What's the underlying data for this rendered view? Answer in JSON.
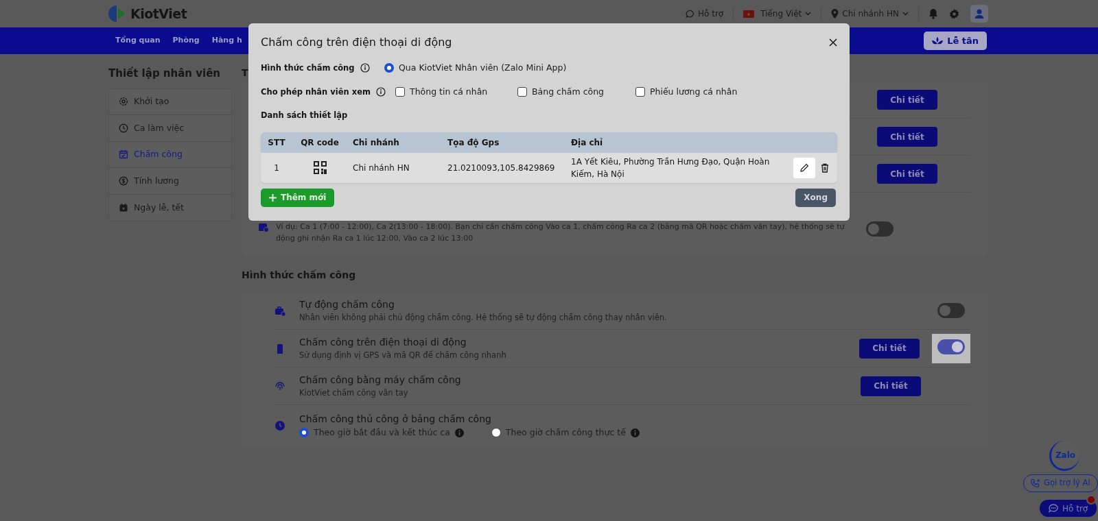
{
  "topbar": {
    "logo": "KiotViet",
    "support": "Hỗ trợ",
    "language": "Tiếng Việt",
    "branch": "Chi nhánh HN"
  },
  "navbar": {
    "items": [
      {
        "label": "Tổng quan"
      },
      {
        "label": "Phòng"
      },
      {
        "label": "Hàng h"
      }
    ],
    "reception_button": "Lễ tân"
  },
  "sidebar": {
    "title": "Thiết lập nhân viên",
    "items": [
      {
        "label": "Khởi tạo",
        "selected": false
      },
      {
        "label": "Ca làm việc",
        "selected": false
      },
      {
        "label": "Chấm công",
        "selected": true
      },
      {
        "label": "Tính lương",
        "selected": false
      },
      {
        "label": "Ngày lễ, tết",
        "selected": false
      }
    ]
  },
  "settings": {
    "heading": "T",
    "rows": [
      {
        "kind": "detail",
        "button": "Chi tiết"
      },
      {
        "kind": "detail",
        "button": "Chi tiết"
      },
      {
        "kind": "detail",
        "button": "Chi tiết"
      },
      {
        "kind": "toggle",
        "description": "Ví dụ: Ca 1 (7:00 - 12:00), Ca 2(13:00 - 18:00). Bạn chỉ cần chấm công Vào ca 1, chấm công Ra ca 2 (bằng mã QR hoặc chấm vân tay), hệ thống sẽ tự động ghi nhận Ra ca 1 lúc 12:00, Vào ca 2 lúc 13:00",
        "on": false
      }
    ]
  },
  "attendance_methods": {
    "title": "Hình thức chấm công",
    "rows": [
      {
        "kind": "toggle",
        "title": "Tự động chấm công",
        "description": "Nhân viên không phải chủ động chấm công. Hệ thống sẽ tự động chấm công thay nhân viên.",
        "on": false
      },
      {
        "kind": "detail_toggle",
        "title": "Chấm công trên điện thoại di động",
        "description": "Sử dụng định vị GPS và mã QR để chấm công nhanh",
        "button": "Chi tiết",
        "on": true
      },
      {
        "kind": "detail",
        "title": "Chấm công bằng máy chấm công",
        "description": "KiotViet chấm công vân tay",
        "button": "Chi tiết"
      },
      {
        "kind": "radios",
        "title": "Chấm công thủ công ở bảng chấm công",
        "options": [
          {
            "label": "Theo giờ bắt đầu và kết thúc ca",
            "selected": true
          },
          {
            "label": "Theo giờ chấm công thực tế",
            "selected": false
          }
        ]
      }
    ]
  },
  "modal": {
    "title": "Chấm công trên điện thoại di động",
    "method_label": "Hình thức chấm công",
    "method_options": [
      {
        "label": "Qua KiotViet Nhân viên (Zalo Mini App)",
        "selected": true
      }
    ],
    "view_label": "Cho phép nhân viên xem",
    "view_options": [
      {
        "label": "Thông tin cá nhân",
        "checked": false
      },
      {
        "label": "Bảng chấm công",
        "checked": false
      },
      {
        "label": "Phiếu lương cá nhân",
        "checked": false
      }
    ],
    "list_title": "Danh sách thiết lập",
    "table": {
      "columns": [
        "STT",
        "QR code",
        "Chi nhánh",
        "Tọa độ Gps",
        "Địa chỉ"
      ],
      "rows": [
        {
          "stt": "1",
          "branch": "Chi nhánh HN",
          "gps": "21.0210093,105.8429869",
          "address": "1A Yết Kiêu, Phường Trần Hưng Đạo, Quận Hoàn Kiếm, Hà Nội"
        }
      ]
    },
    "add_button": "Thêm mới",
    "done_button": "Xong"
  },
  "floating": {
    "zalo": "Zalo",
    "ai_button": "Gọi trợ lý AI",
    "support_button": "Hỗ trợ"
  }
}
